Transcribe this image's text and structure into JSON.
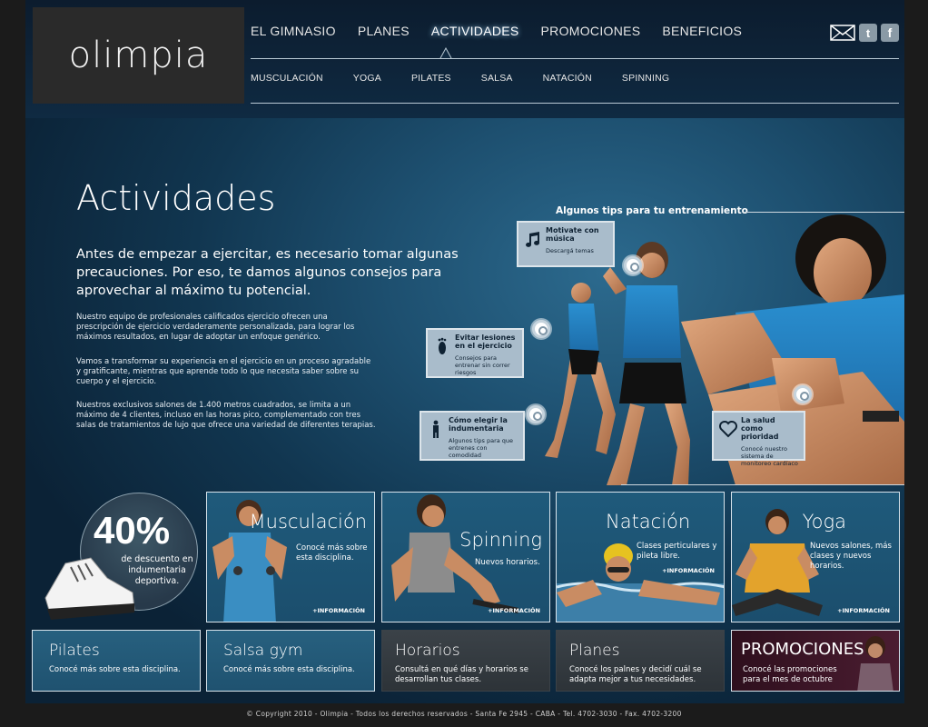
{
  "brand": {
    "logo": "olimpia"
  },
  "nav": {
    "main": [
      "EL GIMNASIO",
      "PLANES",
      "ACTIVIDADES",
      "PROMOCIONES",
      "BENEFICIOS"
    ],
    "active": "ACTIVIDADES",
    "sub": [
      "MUSCULACIÓN",
      "YOGA",
      "PILATES",
      "SALSA",
      "NATACIÓN",
      "SPINNING"
    ]
  },
  "social": {
    "mail_icon": "mail-icon",
    "twitter_icon": "t",
    "facebook_icon": "f"
  },
  "hero": {
    "title": "Actividades",
    "lead": "Antes de empezar a ejercitar, es necesario tomar algunas precauciones. Por eso, te damos algunos consejos para aprovechar al máximo tu potencial.",
    "paragraphs": [
      "Nuestro equipo de profesionales calificados ejercicio ofrecen una prescripción de ejercicio verdaderamente personalizada, para lograr los máximos resultados, en lugar de adoptar un enfoque genérico.",
      "Vamos a transformar su experiencia en el ejercicio en un proceso agradable y gratificante, mientras que aprende todo lo que necesita saber sobre su cuerpo y el ejercicio.",
      "Nuestros exclusivos salones de 1.400 metros cuadrados, se limita a un máximo de 4 clientes, incluso en las horas pico, complementado con tres salas de tratamientos de lujo que ofrece una variedad de diferentes terapias."
    ]
  },
  "tips": {
    "title": "Algunos tips para tu entrenamiento",
    "items": [
      {
        "title": "Motivate con música",
        "sub": "Descargá temas",
        "icon": "music-note-icon"
      },
      {
        "title": "Evitar lesiones en el ejercicio",
        "sub": "Consejos para entrenar sin correr riesgos",
        "icon": "footprint-icon"
      },
      {
        "title": "Cómo elegir la indumentaria",
        "sub": "Algunos tips para que entrenes con comodidad",
        "icon": "person-icon"
      },
      {
        "title": "La salud como prioridad",
        "sub": "Conocé nuestro sistema de monitoreo cardíaco",
        "icon": "heart-icon"
      }
    ]
  },
  "promo": {
    "percent": "40%",
    "text": "de descuento en indumentaria deportiva."
  },
  "tiles_big": [
    {
      "title": "Musculación",
      "desc": "Conocé más sobre esta disciplina.",
      "more": "+INFORMACIÓN"
    },
    {
      "title": "Spinning",
      "desc": "Nuevos horarios.",
      "more": "+INFORMACIÓN"
    },
    {
      "title": "Natación",
      "desc": "Clases perticulares y pileta libre.",
      "more": "+INFORMACIÓN"
    },
    {
      "title": "Yoga",
      "desc": "Nuevos salones, más clases y nuevos horarios.",
      "more": "+INFORMACIÓN"
    }
  ],
  "tiles_small": [
    {
      "title": "Pilates",
      "desc": "Conocé más sobre esta disciplina."
    },
    {
      "title": "Salsa gym",
      "desc": "Conocé más sobre esta disciplina."
    },
    {
      "title": "Horarios",
      "desc": "Consultá en qué días y horarios se desarrollan tus clases."
    },
    {
      "title": "Planes",
      "desc": "Conocé los palnes y decidí cuál se adapta mejor a tus necesidades."
    },
    {
      "title": "PROMOCIONES",
      "desc": "Conocé las promociones para el mes de octubre"
    }
  ],
  "footer": "© Copyright 2010 - Olimpia - Todos los derechos reservados - Santa Fe 2945 - CABA - Tel. 4702-3030 - Fax. 4702-3200",
  "colors": {
    "accent": "#1f5a7b",
    "promo": "#3a1626",
    "dark_tile": "#33393f"
  }
}
